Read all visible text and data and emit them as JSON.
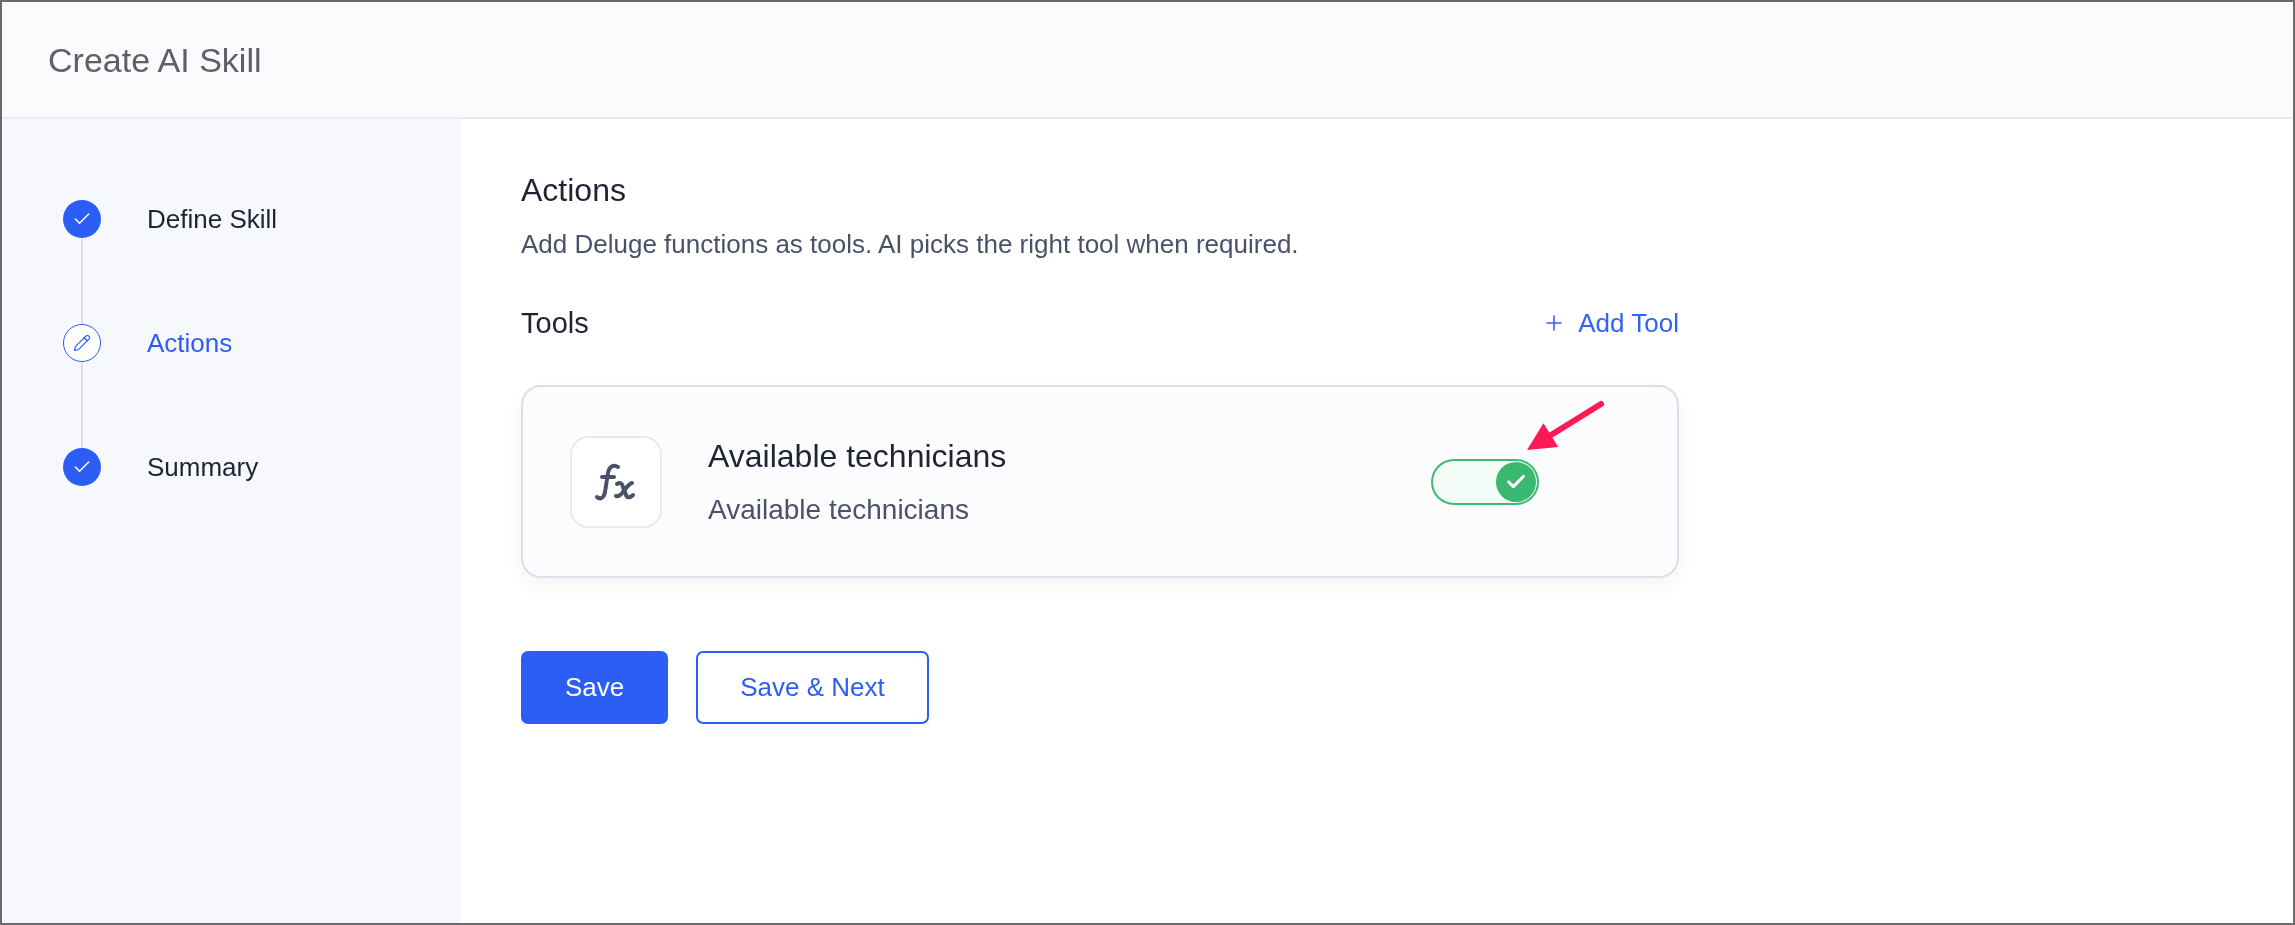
{
  "header": {
    "title": "Create AI Skill"
  },
  "steps": [
    {
      "label": "Define Skill",
      "kind": "done",
      "selected": false
    },
    {
      "label": "Actions",
      "kind": "current",
      "selected": true
    },
    {
      "label": "Summary",
      "kind": "done",
      "selected": false
    }
  ],
  "section": {
    "title": "Actions",
    "description": "Add Deluge functions as tools. AI picks the right tool when required."
  },
  "tools_section": {
    "title": "Tools",
    "add_button": "Add Tool"
  },
  "tools": [
    {
      "name": "Available technicians",
      "description": "Available technicians",
      "enabled": true
    }
  ],
  "buttons": [
    {
      "label": "Save",
      "kind": "primary"
    },
    {
      "label": "Save & Next",
      "kind": "secondary"
    }
  ]
}
